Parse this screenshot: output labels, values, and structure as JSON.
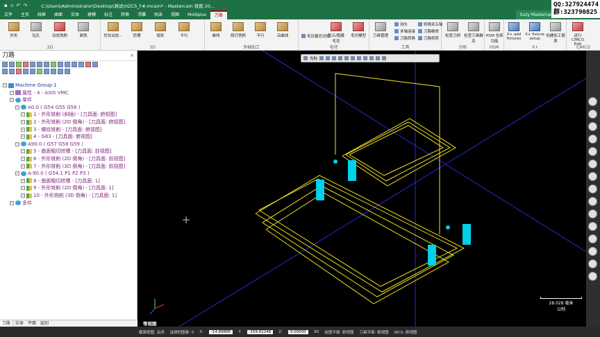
{
  "titlebar": {
    "title": "C:\\Users\\Administrator\\Desktop\\测试\\HZCS_F#.mcam* - Mastercam 铣削 20...",
    "qq_line1": "QQ:327924474",
    "qq_line2": "群:323790825"
  },
  "menubar": {
    "items": [
      "文件",
      "主页",
      "线框",
      "曲面",
      "实体",
      "建模",
      "标注",
      "转换",
      "浮雕",
      "机床",
      "视图",
      "Moldplus",
      "刀路"
    ],
    "active_label": "刀路",
    "user_label": "Suzy Mastercam"
  },
  "ribbon": {
    "groups": {
      "g2d": "2D",
      "g3d": "3D",
      "multiaxis": "多轴加工",
      "blank": "毛坯",
      "tools": "工具",
      "analysis": "分析",
      "hsm": "HSM",
      "xplus": "X+",
      "cimco": "CIMCO"
    },
    "buttons": {
      "contour": "外形",
      "drill": "钻孔",
      "dynamic": "动态铣削",
      "face": "面铣",
      "optimize": "优化动态...",
      "parallel_area": "挖槽",
      "project": "投影",
      "parallel": "平行",
      "curve": "曲线",
      "side": "侧刃铣削",
      "parallel_ma": "平行",
      "deburr": "沿曲线",
      "blank_model": "毛坯模型",
      "blank_show": "显示/隐藏毛坯",
      "tool_mgr": "刀具管理",
      "check_tool": "检查刀柄",
      "check_holder": "检查刀具触及",
      "hsm_all": "HSM 全部功能",
      "xplus_add": "X+ add fixtures",
      "xplus_setup": "X+ fixture setup",
      "create_report": "创建加工报表",
      "cimco_edit": "运行CIMCO Edit"
    },
    "small": {
      "s1": "毛坯剪切",
      "s2": "毛坯着色切换",
      "t1": "刀路转换",
      "t2": "多轴连接",
      "t3": "刀路精修",
      "t4": "转换到五轴",
      "t5": "刀路修剪",
      "t6": "刀路延伸",
      "t7": "测头"
    }
  },
  "panel": {
    "title": "刀路",
    "close": "×",
    "tree": [
      {
        "label": "Machine Group-1",
        "cls": "blue",
        "depth": 0,
        "icon": "mg"
      },
      {
        "label": "属性 - 4 - AXIS VMC",
        "cls": "purple",
        "depth": 1,
        "icon": "prop"
      },
      {
        "label": "单件",
        "cls": "purple",
        "depth": 1,
        "icon": "wcs"
      },
      {
        "label": "A0.0 ( G54 G55 G56 )",
        "cls": "purple",
        "depth": 2,
        "icon": "wcs"
      },
      {
        "label": "1 - 外形铣削 (斜插) - [刀具面: 俯视图]",
        "cls": "purple",
        "depth": 3,
        "icon": "op"
      },
      {
        "label": "2 - 外形铣削 (2D 倒角) - [刀具面: 俯视图]",
        "cls": "purple",
        "depth": 3,
        "icon": "op"
      },
      {
        "label": "3 - 螺纹铣削 - [刀具面: 俯视图]",
        "cls": "purple",
        "depth": 3,
        "icon": "op"
      },
      {
        "label": "4 - G83 - [刀具面: 俯视图]",
        "cls": "purple",
        "depth": 3,
        "icon": "op"
      },
      {
        "label": "A90.0 ( G57 G58 G59 )",
        "cls": "purple",
        "depth": 2,
        "icon": "wcs"
      },
      {
        "label": "5 - 曲面粗切挖槽 - [刀具面: 前视图]",
        "cls": "purple",
        "depth": 3,
        "icon": "op"
      },
      {
        "label": "6 - 外形铣削 (2D 倒角) - [刀具面: 前视图]",
        "cls": "purple",
        "depth": 3,
        "icon": "op"
      },
      {
        "label": "7 - 外形铣削 (3D 倒角) - [刀具面: 前视图]",
        "cls": "purple",
        "depth": 3,
        "icon": "op"
      },
      {
        "label": "A-90.0 ( G54.1 P1 P2 P3 )",
        "cls": "purple",
        "depth": 2,
        "icon": "wcs"
      },
      {
        "label": "8 - 曲面粗切挖槽 - [刀具面: 1]",
        "cls": "purple",
        "depth": 3,
        "icon": "op"
      },
      {
        "label": "9 - 外形铣削 (2D 倒角) - [刀具面: 1]",
        "cls": "purple",
        "depth": 3,
        "icon": "op"
      },
      {
        "label": "10 - 外形铣削 (3D 倒角) - [刀具面: 1]",
        "cls": "purple",
        "depth": 3,
        "icon": "op"
      },
      {
        "label": "多件",
        "cls": "purple",
        "depth": 1,
        "icon": "wcs"
      }
    ],
    "tabs": [
      "刀路",
      "实体",
      "平面",
      "层别"
    ]
  },
  "viewport": {
    "toolbar_label": "光标",
    "view_name": "等视图",
    "scale_value": "28.028 毫米",
    "scale_unit": "公制"
  },
  "statusbar": {
    "section_view": "截面视图: 关闭",
    "selected": "选择的图素: 0",
    "x_label": "X:",
    "x_value": "-14.89886",
    "y_label": "Y:",
    "y_value": "-159.61248",
    "z_label": "Z:",
    "z_value": "0.00000",
    "mode": "3D",
    "gplane": "绘图平面: 俯视图",
    "tplane": "刀具平面: 俯视图",
    "wcs": "WCS: 俯视图"
  },
  "colors": {
    "accent": "#1e7145",
    "toolpath": "#f0e020",
    "tool": "#00c8e0",
    "axis": "#3030ff"
  }
}
